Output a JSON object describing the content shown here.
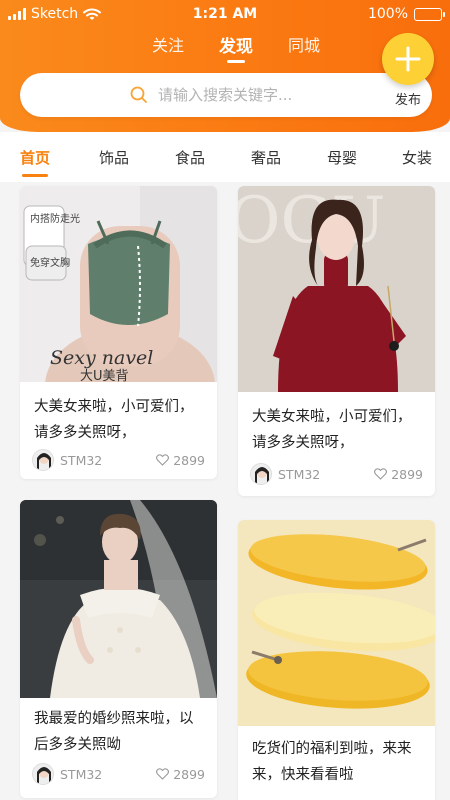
{
  "status_bar": {
    "carrier": "Sketch",
    "time": "1:21 AM",
    "battery_text": "100%",
    "battery_level": 1.0
  },
  "header": {
    "tabs": [
      {
        "label": "关注",
        "active": false
      },
      {
        "label": "发现",
        "active": true
      },
      {
        "label": "同城",
        "active": false
      }
    ],
    "search": {
      "placeholder": "请输入搜索关键字..."
    },
    "publish_label": "发布"
  },
  "categories": [
    {
      "label": "首页",
      "active": true
    },
    {
      "label": "饰品",
      "active": false
    },
    {
      "label": "食品",
      "active": false
    },
    {
      "label": "奢品",
      "active": false
    },
    {
      "label": "母婴",
      "active": false
    },
    {
      "label": "女装",
      "active": false
    }
  ],
  "cards": [
    {
      "image": "lingerie-photo",
      "image_texts": [
        "内搭防走光",
        "免穿文胸",
        "Sexy navel",
        "大U美背"
      ],
      "title": "大美女来啦，小可爱们，请多多关照呀，",
      "author": "STM32",
      "likes": "2899"
    },
    {
      "image": "red-lace-dress-photo",
      "image_texts": [
        "OGU"
      ],
      "title": "大美女来啦，小可爱们，请多多关照呀，",
      "author": "STM32",
      "likes": "2899"
    },
    {
      "image": "wedding-dress-photo",
      "title": "我最爱的婚纱照来啦，以后多多关照呦",
      "author": "STM32",
      "likes": "2899"
    },
    {
      "image": "mango-slices-photo",
      "title": "吃货们的福利到啦，来来来，快来看看啦",
      "author": "STM32",
      "likes": "2899"
    }
  ],
  "colors": {
    "accent": "#f8820f",
    "header_start": "#fa8a1c",
    "header_end": "#f86e0c",
    "publish_button": "#fdd135",
    "text_primary": "#222222",
    "text_secondary": "#999999"
  }
}
